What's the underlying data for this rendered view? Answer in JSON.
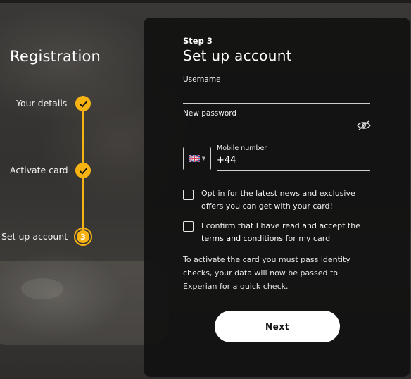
{
  "left": {
    "title": "Registration",
    "steps": [
      {
        "label": "Your details",
        "state": "done"
      },
      {
        "label": "Activate card",
        "state": "done"
      },
      {
        "label": "Set up account",
        "state": "current",
        "number": "3"
      }
    ]
  },
  "form": {
    "step_number": "Step 3",
    "title": "Set up account",
    "username_label": "Username",
    "password_label": "New password",
    "mobile_label": "Mobile number",
    "mobile_value": "+44",
    "country_flag": "uk-flag-icon",
    "optin_text": "Opt in for the latest news and exclusive offers you can get with your card!",
    "terms_prefix": "I confirm that I have read and accept the",
    "terms_link": "terms and conditions",
    "terms_suffix": "for my card",
    "note": "To activate the card you must pass identity checks, your data will now be passed to Experian for a quick check.",
    "next_label": "Next"
  },
  "colors": {
    "accent": "#f6b312",
    "panel": "#111111",
    "button": "#ffffff"
  }
}
